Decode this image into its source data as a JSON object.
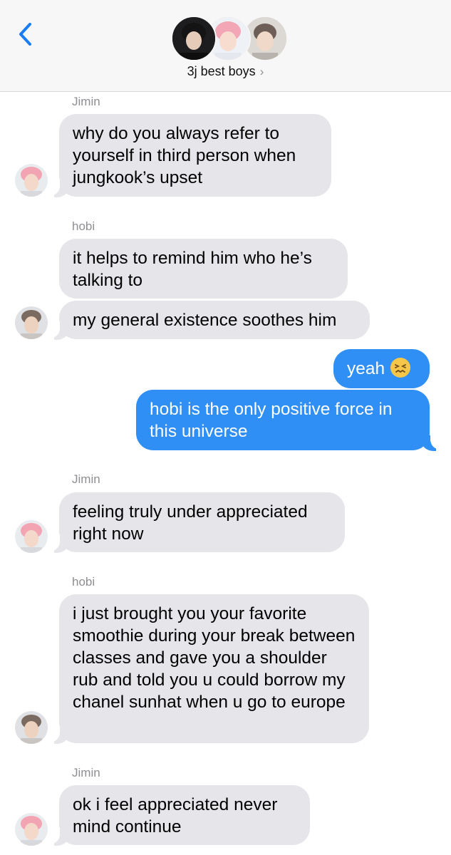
{
  "header": {
    "group_name": "3j best boys",
    "chevron": "›",
    "back_icon": "chevron-left-icon"
  },
  "messages": [
    {
      "sender": "Jimin",
      "direction": "incoming",
      "text": "why do you always refer to yourself in third person when jungkook’s upset"
    },
    {
      "sender": "hobi",
      "direction": "incoming",
      "text": "it helps to remind him who he’s talking to"
    },
    {
      "sender": "hobi",
      "direction": "incoming",
      "text": "my general existence soothes him"
    },
    {
      "sender": "me",
      "direction": "outgoing",
      "text": "yeah",
      "emoji": "confounded-face"
    },
    {
      "sender": "me",
      "direction": "outgoing",
      "text": "hobi is the only positive force in this universe"
    },
    {
      "sender": "Jimin",
      "direction": "incoming",
      "text": "feeling truly under appreciated right now"
    },
    {
      "sender": "hobi",
      "direction": "incoming",
      "text": "i just brought you your favorite smoothie during your break between classes and gave you a shoulder rub and told you u could borrow my chanel sunhat when u go to europe"
    },
    {
      "sender": "Jimin",
      "direction": "incoming",
      "text": "ok i feel appreciated never mind continue"
    }
  ],
  "colors": {
    "incoming_bubble": "#e5e5ea",
    "outgoing_bubble": "#2f8ff5",
    "accent": "#1a7cf5"
  }
}
